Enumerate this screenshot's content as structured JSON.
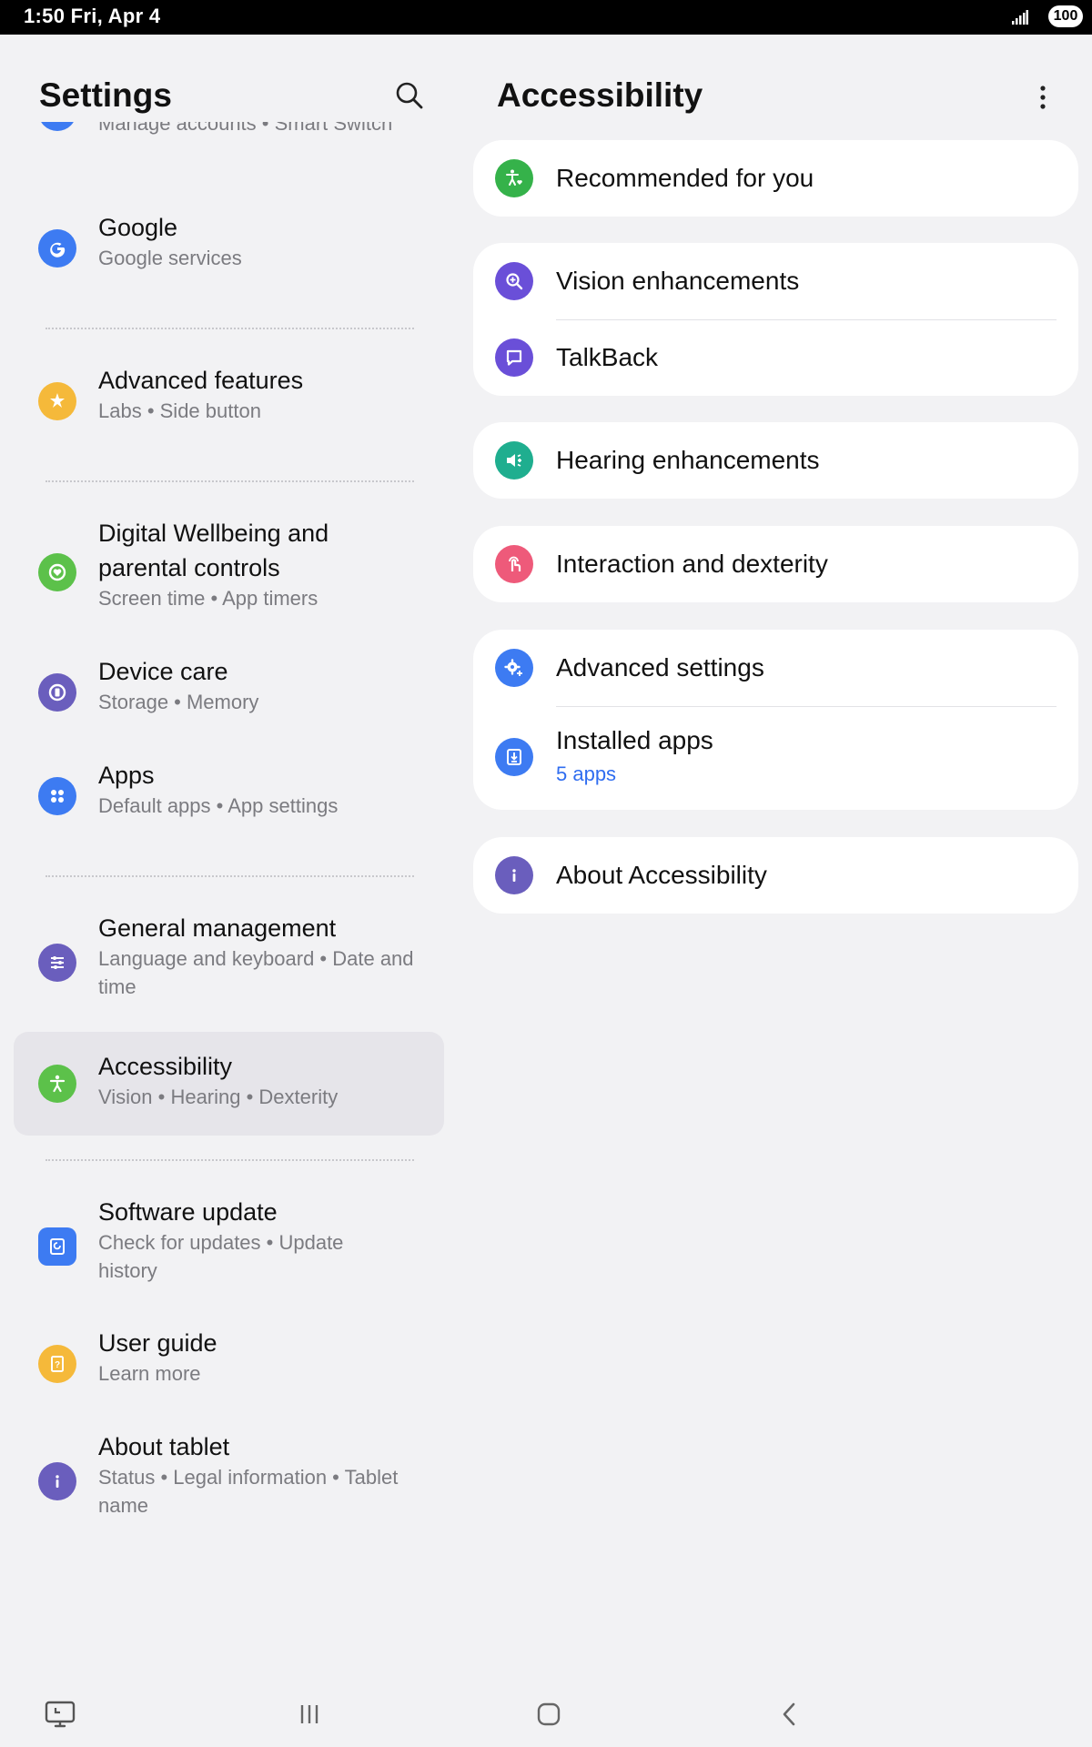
{
  "status_bar": {
    "time": "1:50  Fri, Apr 4",
    "battery": "100"
  },
  "left_pane": {
    "title": "Settings",
    "items": [
      {
        "title": "",
        "subtitle": "Manage accounts  •  Smart Switch",
        "icon": "accounts-icon",
        "color": "#3d7bf2"
      },
      {
        "title": "Google",
        "subtitle": "Google services",
        "icon": "google-icon",
        "color": "#3d7bf2"
      },
      {
        "title": "Advanced features",
        "subtitle": "Labs  •  Side button",
        "icon": "advanced-features-icon",
        "color": "#f5b93a"
      },
      {
        "title": "Digital Wellbeing and parental controls",
        "subtitle": "Screen time  •  App timers",
        "icon": "wellbeing-icon",
        "color": "#5cc14a"
      },
      {
        "title": "Device care",
        "subtitle": "Storage  •  Memory",
        "icon": "device-care-icon",
        "color": "#6a5ebd"
      },
      {
        "title": "Apps",
        "subtitle": "Default apps  •  App settings",
        "icon": "apps-icon",
        "color": "#3d7bf2"
      },
      {
        "title": "General management",
        "subtitle": "Language and keyboard  •  Date and time",
        "icon": "general-management-icon",
        "color": "#6a5ebd"
      },
      {
        "title": "Accessibility",
        "subtitle": "Vision  •  Hearing  •  Dexterity",
        "icon": "accessibility-icon",
        "color": "#5cc14a"
      },
      {
        "title": "Software update",
        "subtitle": "Check for updates  •  Update history",
        "icon": "software-update-icon",
        "color": "#3d7bf2"
      },
      {
        "title": "User guide",
        "subtitle": "Learn more",
        "icon": "user-guide-icon",
        "color": "#f5b93a"
      },
      {
        "title": "About tablet",
        "subtitle": "Status  •  Legal information  •  Tablet name",
        "icon": "about-tablet-icon",
        "color": "#6a5ebd"
      }
    ]
  },
  "right_pane": {
    "title": "Accessibility",
    "cards": [
      {
        "rows": [
          {
            "label": "Recommended for you",
            "icon": "recommended-icon",
            "color": "#35b24a"
          }
        ]
      },
      {
        "rows": [
          {
            "label": "Vision enhancements",
            "icon": "vision-icon",
            "color": "#6a4fd8"
          },
          {
            "label": "TalkBack",
            "icon": "talkback-icon",
            "color": "#6a4fd8"
          }
        ]
      },
      {
        "rows": [
          {
            "label": "Hearing enhancements",
            "icon": "hearing-icon",
            "color": "#1fae8f"
          }
        ]
      },
      {
        "rows": [
          {
            "label": "Interaction and dexterity",
            "icon": "interaction-icon",
            "color": "#ee5a7a"
          }
        ]
      },
      {
        "rows": [
          {
            "label": "Advanced settings",
            "icon": "advanced-settings-icon",
            "color": "#3d7bf2"
          },
          {
            "label": "Installed apps",
            "sublabel": "5 apps",
            "icon": "installed-apps-icon",
            "color": "#3d7bf2"
          }
        ]
      },
      {
        "rows": [
          {
            "label": "About Accessibility",
            "icon": "about-accessibility-icon",
            "color": "#6a5ebd"
          }
        ]
      }
    ]
  },
  "navigation_bar": {
    "icons": [
      "screenshot-icon",
      "recents-icon",
      "home-icon",
      "back-icon"
    ]
  }
}
